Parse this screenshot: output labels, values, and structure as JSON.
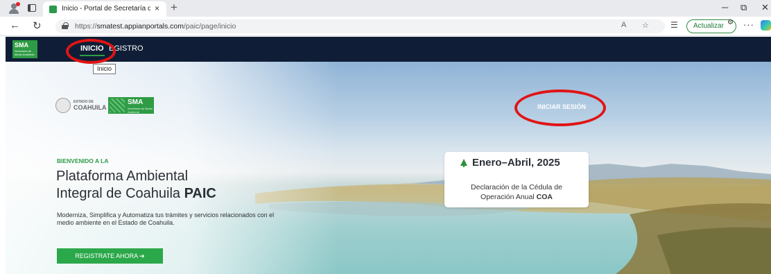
{
  "browser": {
    "tab_title": "Inicio - Portal de Secretaría de Medio",
    "tab_close": "×",
    "new_tab": "+",
    "url_prefix": "https://",
    "url_host": "smatest.appianportals.com",
    "url_path": "/paic/page/inicio",
    "update_label": "Actualizar",
    "more_icon": "···",
    "icons": [
      "profile-icon",
      "workspaces-icon",
      "back-icon",
      "refresh-icon",
      "lock-icon",
      "read-aloud-icon",
      "favorite-icon",
      "favorites-icon",
      "update-icon",
      "more-icon",
      "copilot-icon",
      "minimize-icon",
      "restore-icon",
      "close-icon"
    ]
  },
  "site": {
    "logo_text": "SMA",
    "logo_subtext": "Secretaría de Medio Ambiente",
    "nav": {
      "inicio": "INICIO",
      "registro": "EGISTRO"
    },
    "tooltip": "Inicio",
    "accent_color": "#2ba84a",
    "navbar_color": "#0f1e36"
  },
  "hero": {
    "state_logo_small": "ESTADO DE",
    "state_logo_big": "COAHUILA",
    "login_link": "INICIAR SESIÓN",
    "welcome": "BIENVENIDO A LA",
    "title_line1": "Plataforma Ambiental",
    "title_line2_plain": "Integral de Coahuila ",
    "title_line2_bold": "PAIC",
    "description": "Moderniza, Simplifica y Automatiza tus trámites y servicios relacionados con el medio ambiente en el Estado de Coahuila.",
    "register_button": "REGISTRATE AHORA ➔",
    "card": {
      "period": "Enero–Abril, 2025",
      "line1": "Declaración de la Cédula de",
      "line2_plain": "Operación Anual ",
      "line2_bold": "COA"
    }
  },
  "annotations": {
    "highlight_color": "#e01414"
  }
}
